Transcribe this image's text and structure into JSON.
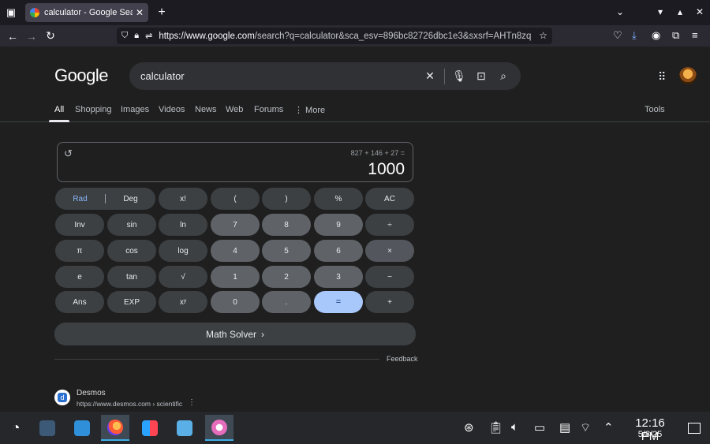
{
  "browser": {
    "tab_title": "calculator - Google Search",
    "new_tab": "+",
    "url_domain": "https://www.google.com",
    "url_rest": "/search?q=calculator&sca_esv=896bc82726dbc1e3&sxsrf=AHTn8zq"
  },
  "google": {
    "logo": "Google",
    "query": "calculator",
    "tabs": [
      "All",
      "Shopping",
      "Images",
      "Videos",
      "News",
      "Web",
      "Forums",
      "⋮ More"
    ],
    "tools": "Tools"
  },
  "calculator": {
    "expression": "827 + 146 + 27 =",
    "result": "1000",
    "rad": "Rad",
    "deg": "Deg",
    "keys": [
      [
        "x!",
        "(",
        ")",
        "%",
        "AC"
      ],
      [
        "Inv",
        "sin",
        "ln",
        "7",
        "8",
        "9",
        "÷"
      ],
      [
        "π",
        "cos",
        "log",
        "4",
        "5",
        "6",
        "×"
      ],
      [
        "e",
        "tan",
        "√",
        "1",
        "2",
        "3",
        "−"
      ],
      [
        "Ans",
        "EXP",
        "xʸ",
        "0",
        ".",
        "=",
        "+"
      ]
    ],
    "math_solver": "Math Solver",
    "feedback": "Feedback"
  },
  "result": {
    "name": "Desmos",
    "url": "https://www.desmos.com › scientific"
  },
  "taskbar": {
    "time": "12:16 PM",
    "date": "5/8/25"
  }
}
